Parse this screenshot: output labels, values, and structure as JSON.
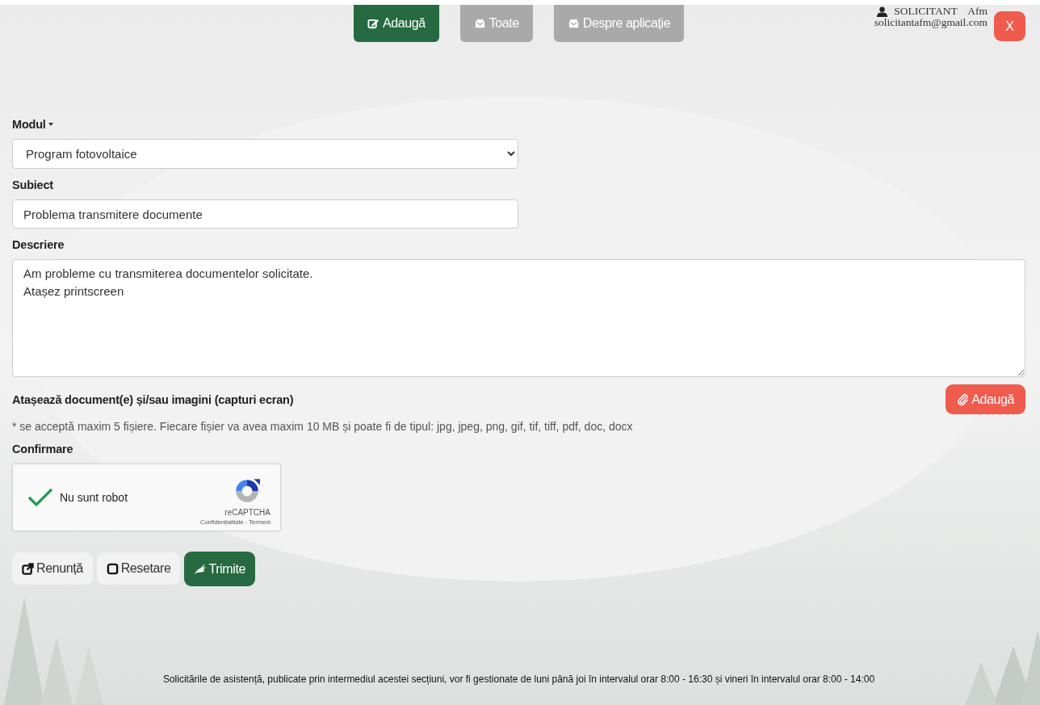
{
  "nav": {
    "tabs": [
      {
        "label": "Adaugă",
        "kind": "add",
        "selected": true
      },
      {
        "label": "Toate",
        "kind": "list",
        "selected": false
      },
      {
        "label": "Despre aplicație",
        "kind": "about",
        "selected": false
      }
    ]
  },
  "user": {
    "name": "SOLICITANT    Afm",
    "email": "solicitantafm@gmail.com",
    "close": "X"
  },
  "form": {
    "module": {
      "label": "Modul",
      "value": "Program fotovoltaice"
    },
    "subject": {
      "label": "Subiect",
      "value": "Problema transmitere documente"
    },
    "description": {
      "label": "Descriere",
      "value": "Am probleme cu transmiterea documentelor solicitate.\nAtașez printscreen"
    },
    "attachments": {
      "label": "Atașează document(e) și/sau imagini (capturi ecran)",
      "button": "Adaugă",
      "note": "* se acceptă maxim 5 fișiere. Fiecare fișier va avea maxim 10 MB și poate fi de tipul: jpg, jpeg, png, gif, tif, tiff, pdf, doc, docx"
    },
    "confirmation": {
      "label": "Confirmare",
      "captcha": {
        "text": "Nu sunt robot",
        "checked": true,
        "brand": "reCAPTCHA",
        "links": "Confidențialitate - Termeni"
      }
    },
    "buttons": [
      {
        "label": "Renunță",
        "kind": "cancel"
      },
      {
        "label": "Resetare",
        "kind": "reset"
      },
      {
        "label": "Trimite",
        "kind": "submit"
      }
    ]
  },
  "footer": {
    "note": "Solicitările de asistență, publicate prin intermediul acestei secțiuni, vor fi gestionate de luni până joi în intervalul orar 8:00 - 16:30 și vineri în intervalul orar 8:00 - 14:00"
  }
}
